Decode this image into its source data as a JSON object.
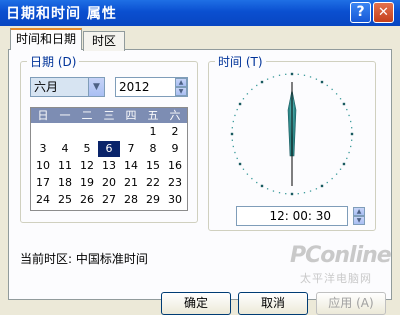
{
  "window": {
    "title": "日期和时间 属性",
    "help_glyph": "?",
    "close_glyph": "✕"
  },
  "tabs": [
    {
      "label": "时间和日期",
      "active": true
    },
    {
      "label": "时区",
      "active": false
    }
  ],
  "date_group": {
    "label": "日期 (D)",
    "month": "六月",
    "year": "2012",
    "weekdays": [
      "日",
      "一",
      "二",
      "三",
      "四",
      "五",
      "六"
    ],
    "days": [
      [
        "",
        "",
        "",
        "",
        "",
        "1",
        "2"
      ],
      [
        "3",
        "4",
        "5",
        "6",
        "7",
        "8",
        "9"
      ],
      [
        "10",
        "11",
        "12",
        "13",
        "14",
        "15",
        "16"
      ],
      [
        "17",
        "18",
        "19",
        "20",
        "21",
        "22",
        "23"
      ],
      [
        "24",
        "25",
        "26",
        "27",
        "28",
        "29",
        "30"
      ]
    ],
    "selected_day": "6"
  },
  "time_group": {
    "label": "时间 (T)",
    "time": "12: 00: 30"
  },
  "timezone": {
    "text": "当前时区: 中国标准时间"
  },
  "buttons": {
    "ok": "确定",
    "cancel": "取消",
    "apply": "应用 (A)"
  },
  "watermark": {
    "logo": "PConline",
    "sub": "太平洋电脑网"
  },
  "colors": {
    "title_bar": "#0a4fd0",
    "selected_day": "#0a246a",
    "clock_hand": "#2f8a8a",
    "tab_accent": "#e68b2c"
  }
}
